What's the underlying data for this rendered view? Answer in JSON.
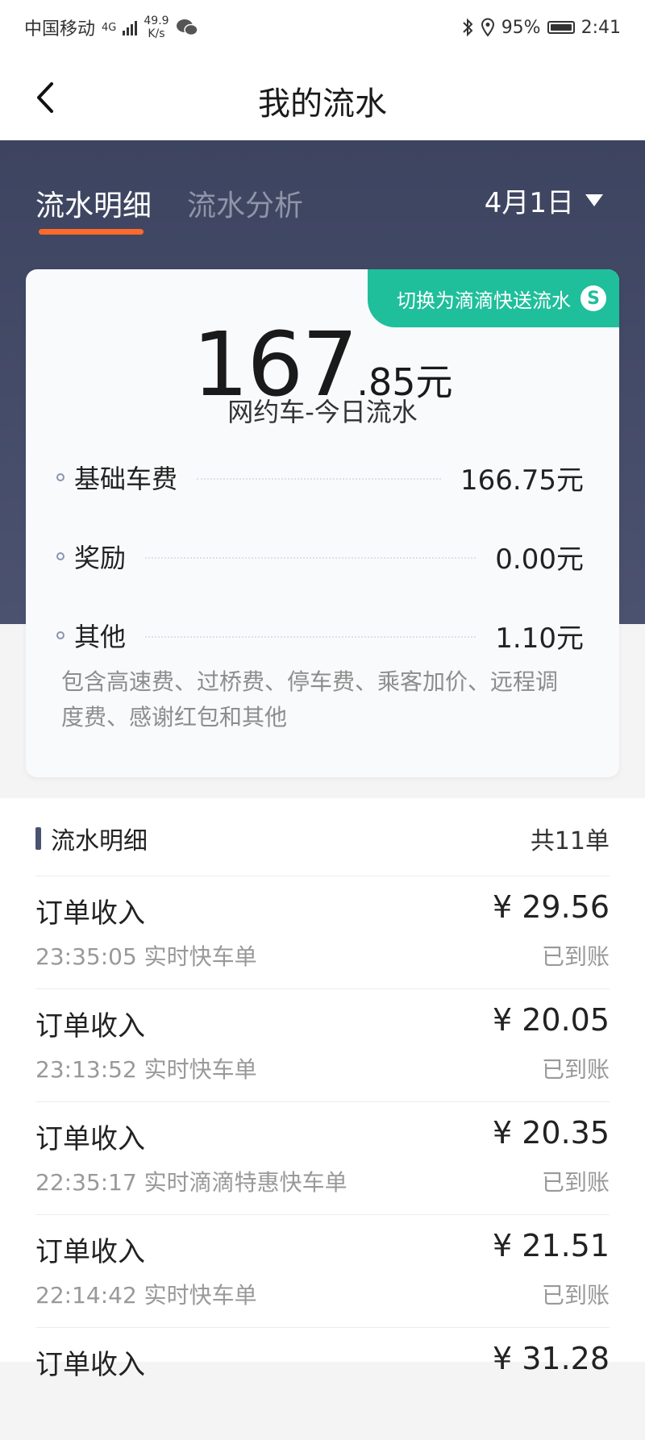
{
  "status_bar": {
    "carrier": "中国移动",
    "network": "4G",
    "speed_value": "49.9",
    "speed_unit": "K/s",
    "battery": "95%",
    "time": "2:41"
  },
  "nav": {
    "title": "我的流水"
  },
  "tabs": [
    {
      "label": "流水明细",
      "active": true
    },
    {
      "label": "流水分析",
      "active": false
    }
  ],
  "date_picker": {
    "label": "4月1日"
  },
  "summary": {
    "switch_label": "切换为滴滴快送流水",
    "switch_icon": "S",
    "amount_int": "167",
    "amount_dec": ".85元",
    "amount_label": "网约车-今日流水",
    "fees": [
      {
        "name": "基础车费",
        "value": "166.75元"
      },
      {
        "name": "奖励",
        "value": "0.00元"
      },
      {
        "name": "其他",
        "value": "1.10元"
      }
    ],
    "note": "包含高速费、过桥费、停车费、乘客加价、远程调度费、感谢红包和其他"
  },
  "list": {
    "title": "流水明细",
    "count": "共11单",
    "items": [
      {
        "title": "订单收入",
        "time": "23:35:05",
        "type": "实时快车单",
        "amount": "¥ 29.56",
        "status": "已到账"
      },
      {
        "title": "订单收入",
        "time": "23:13:52",
        "type": "实时快车单",
        "amount": "¥ 20.05",
        "status": "已到账"
      },
      {
        "title": "订单收入",
        "time": "22:35:17",
        "type": "实时滴滴特惠快车单",
        "amount": "¥ 20.35",
        "status": "已到账"
      },
      {
        "title": "订单收入",
        "time": "22:14:42",
        "type": "实时快车单",
        "amount": "¥ 21.51",
        "status": "已到账"
      },
      {
        "title": "订单收入",
        "time": "",
        "type": "",
        "amount": "¥ 31.28",
        "status": ""
      }
    ]
  },
  "colors": {
    "header_bg": "#444b68",
    "accent_orange": "#ff6a2a",
    "badge_green": "#1fbf9b"
  }
}
